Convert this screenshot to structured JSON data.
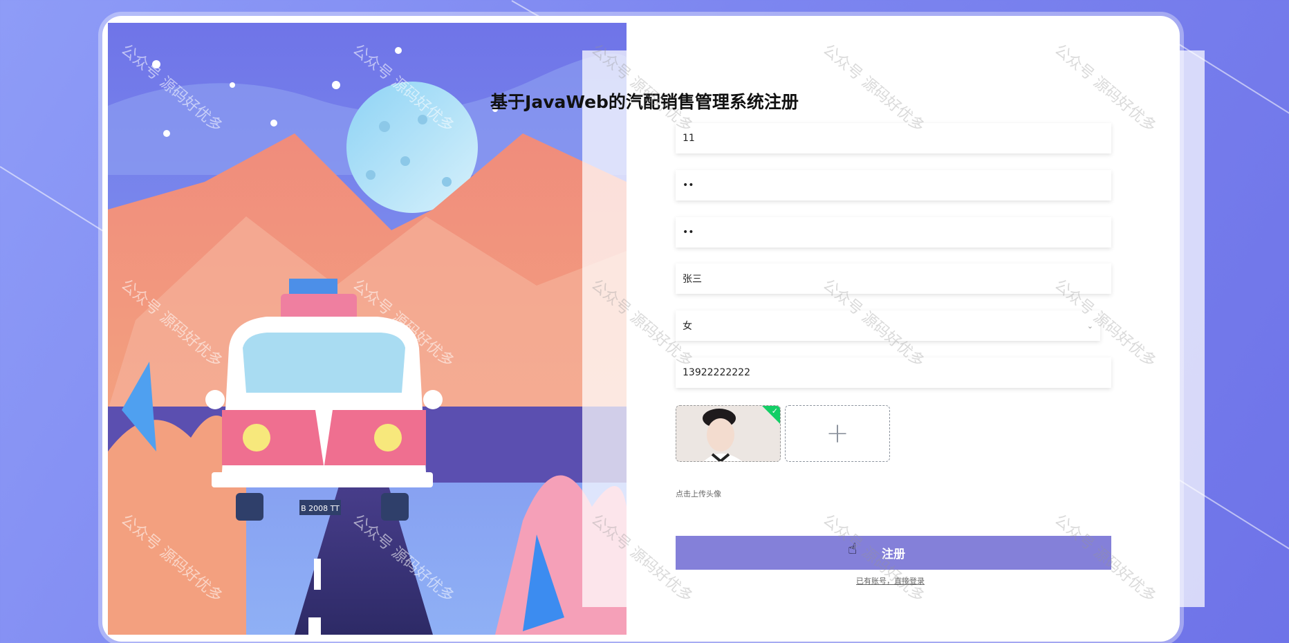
{
  "form": {
    "title": "基于JavaWeb的汽配销售管理系统注册",
    "username_value": "11",
    "password_value": "••",
    "confirm_password_value": "••",
    "name_value": "张三",
    "gender_value": "女",
    "phone_value": "13922222222",
    "upload_hint": "点击上传头像",
    "submit_label": "注册",
    "login_link": "已有账号，直接登录"
  },
  "illustration": {
    "license_plate": "B 2008 TT"
  },
  "watermark": "公众号 源码好优多",
  "colors": {
    "accent": "#8480d9",
    "background": "#7d86f0",
    "upload_success": "#13ce66"
  },
  "icons": {
    "select_arrow": "chevron-down-icon",
    "add": "plus-icon",
    "success": "check-icon",
    "cursor": "hand-pointer-icon"
  }
}
